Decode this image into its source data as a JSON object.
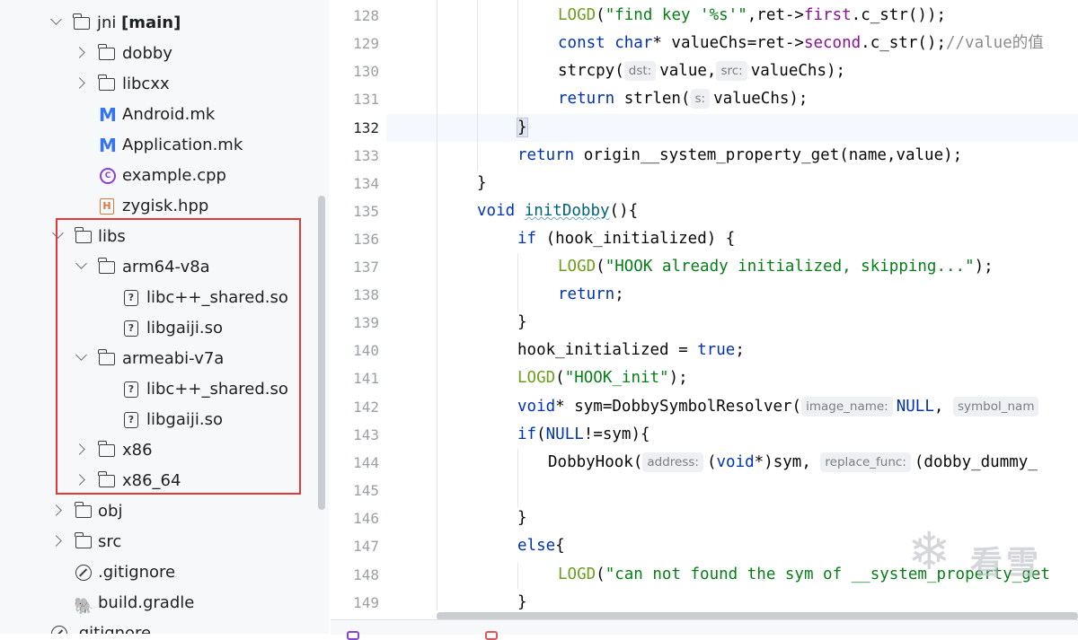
{
  "project_tree": {
    "items": [
      {
        "label": "jni",
        "branch": "[main]",
        "type": "module",
        "expanded": true
      },
      {
        "label": "dobby",
        "type": "folder",
        "expanded": false
      },
      {
        "label": "libcxx",
        "type": "folder",
        "expanded": false
      },
      {
        "label": "Android.mk",
        "type": "makefile"
      },
      {
        "label": "Application.mk",
        "type": "makefile"
      },
      {
        "label": "example.cpp",
        "type": "cpp"
      },
      {
        "label": "zygisk.hpp",
        "type": "header"
      },
      {
        "label": "libs",
        "type": "folder",
        "expanded": true
      },
      {
        "label": "arm64-v8a",
        "type": "folder",
        "expanded": true
      },
      {
        "label": "libc++_shared.so",
        "type": "unknown"
      },
      {
        "label": "libgaiji.so",
        "type": "unknown"
      },
      {
        "label": "armeabi-v7a",
        "type": "folder",
        "expanded": true
      },
      {
        "label": "libc++_shared.so",
        "type": "unknown"
      },
      {
        "label": "libgaiji.so",
        "type": "unknown"
      },
      {
        "label": "x86",
        "type": "folder",
        "expanded": false
      },
      {
        "label": "x86_64",
        "type": "folder",
        "expanded": false
      },
      {
        "label": "obj",
        "type": "folder",
        "expanded": false
      },
      {
        "label": "src",
        "type": "folder",
        "expanded": false
      },
      {
        "label": ".gitignore",
        "type": "ignore"
      },
      {
        "label": "build.gradle",
        "type": "gradle"
      },
      {
        "label": ".gitignore",
        "type": "ignore"
      }
    ]
  },
  "editor": {
    "active_line": "132",
    "lines": [
      {
        "n": "128",
        "t1": "LOGD",
        "t2": "(",
        "t3": "\"find key '%s'\"",
        "t4": ",ret->",
        "t5": "first",
        "t6": ".c_str());"
      },
      {
        "n": "129",
        "t1": "const char",
        "t2": "* valueChs=ret->",
        "t3": "second",
        "t4": ".c_str();",
        "t5": "//value的值"
      },
      {
        "n": "130",
        "t1": "strcpy(",
        "h1": "dst:",
        "t2": "value,",
        "h2": "src:",
        "t3": "valueChs);"
      },
      {
        "n": "131",
        "t1": "return",
        "t2": " strlen(",
        "h1": "s:",
        "t3": "valueChs);"
      },
      {
        "n": "132",
        "t1": "}"
      },
      {
        "n": "133",
        "t1": "return",
        "t2": " origin__system_property_get(name,value);"
      },
      {
        "n": "134",
        "t1": "}"
      },
      {
        "n": "135",
        "t1": "void",
        "t2": " ",
        "t3": "initDobby",
        "t4": "(){"
      },
      {
        "n": "136",
        "t1": "if",
        "t2": " (hook_initialized) {"
      },
      {
        "n": "137",
        "t1": "LOGD",
        "t2": "(",
        "t3": "\"HOOK already initialized, skipping...\"",
        "t4": ");"
      },
      {
        "n": "138",
        "t1": "return",
        "t2": ";"
      },
      {
        "n": "139",
        "t1": "}"
      },
      {
        "n": "140",
        "t1": "hook_initialized = ",
        "t2": "true",
        "t3": ";"
      },
      {
        "n": "141",
        "t1": "LOGD",
        "t2": "(",
        "t3": "\"HOOK_init\"",
        "t4": ");"
      },
      {
        "n": "142",
        "t1": "void",
        "t2": "* sym=DobbySymbolResolver(",
        "h1": "image_name:",
        "t3": "NULL",
        "t4": ",",
        "h2": "symbol_nam"
      },
      {
        "n": "143",
        "t1": "if",
        "t2": "(",
        "t3": "NULL",
        "t4": "!=sym){"
      },
      {
        "n": "144",
        "t1": "DobbyHook(",
        "h1": "address:",
        "t2": "(",
        "t3": "void",
        "t4": "*)sym,",
        "h2": "replace_func:",
        "t5": "(dobby_dummy_"
      },
      {
        "n": "145"
      },
      {
        "n": "146",
        "t1": "}"
      },
      {
        "n": "147",
        "t1": "else",
        "t2": "{"
      },
      {
        "n": "148",
        "t1": "LOGD",
        "t2": "(",
        "t3": "\"can not found the sym of __system_property_get"
      },
      {
        "n": "149",
        "t1": "}"
      }
    ]
  },
  "watermark": {
    "text": "看雪"
  },
  "colors": {
    "highlight_box": "#e53935",
    "keyword": "#0033b3",
    "string": "#067d17",
    "macro": "#6c9e1e"
  }
}
